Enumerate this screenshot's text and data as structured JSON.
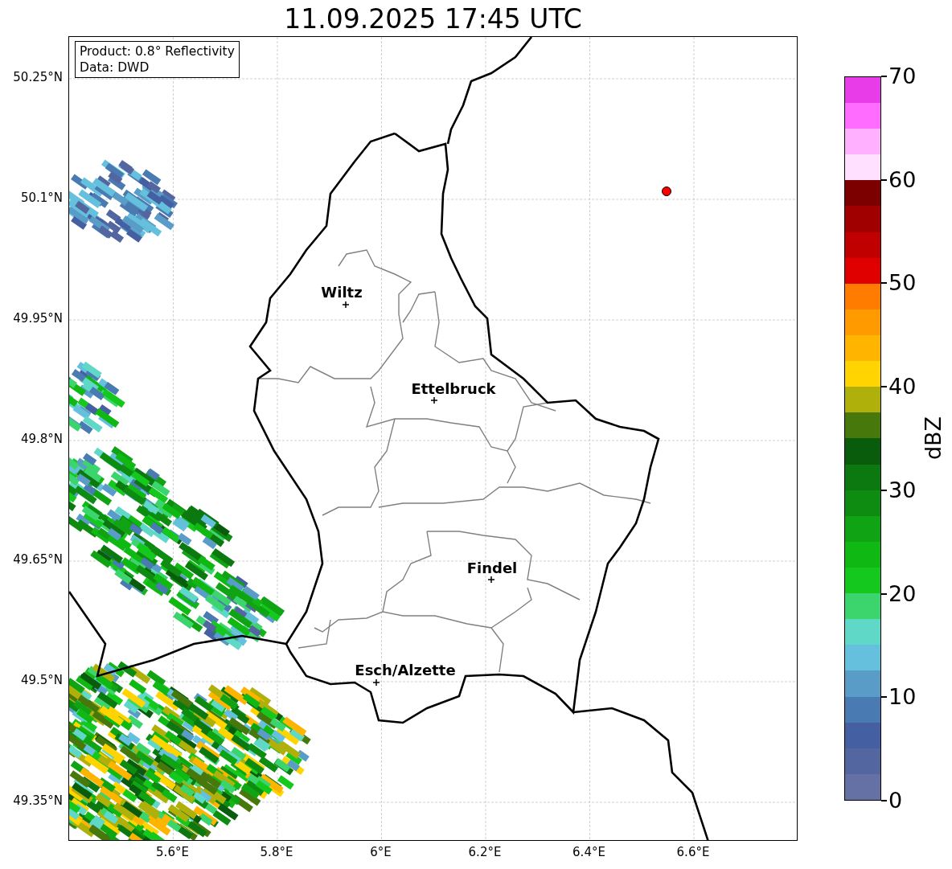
{
  "title": "11.09.2025 17:45 UTC",
  "info_box": {
    "lines": [
      "Product: 0.8° Reflectivity",
      "Data: DWD"
    ]
  },
  "map": {
    "y_ticks": [
      "50.25°N",
      "50.1°N",
      "49.95°N",
      "49.8°N",
      "49.65°N",
      "49.5°N",
      "49.35°N"
    ],
    "x_ticks": [
      "5.6°E",
      "5.8°E",
      "6°E",
      "6.2°E",
      "6.4°E",
      "6.6°E"
    ],
    "cities": [
      {
        "name": "Wiltz"
      },
      {
        "name": "Ettelbruck"
      },
      {
        "name": "Findel"
      },
      {
        "name": "Esch/Alzette"
      }
    ]
  },
  "colorbar": {
    "label": "dBZ",
    "ticks": [
      "70",
      "60",
      "50",
      "40",
      "30",
      "20",
      "10",
      "0"
    ],
    "bins": [
      {
        "color": "#6570a5"
      },
      {
        "color": "#5466a0"
      },
      {
        "color": "#4460a3"
      },
      {
        "color": "#4a7ab2"
      },
      {
        "color": "#5a9cc8"
      },
      {
        "color": "#64c0dc"
      },
      {
        "color": "#60d8c8"
      },
      {
        "color": "#3cd46c"
      },
      {
        "color": "#14c81e"
      },
      {
        "color": "#10b814"
      },
      {
        "color": "#10a414"
      },
      {
        "color": "#0e8c12"
      },
      {
        "color": "#0c7810"
      },
      {
        "color": "#085c0c"
      },
      {
        "color": "#46780c"
      },
      {
        "color": "#b0b00a"
      },
      {
        "color": "#ffd400"
      },
      {
        "color": "#ffb400"
      },
      {
        "color": "#ff9a00"
      },
      {
        "color": "#ff7c00"
      },
      {
        "color": "#e00000"
      },
      {
        "color": "#c00000"
      },
      {
        "color": "#a00000"
      },
      {
        "color": "#7c0000"
      },
      {
        "color": "#ffe0ff"
      },
      {
        "color": "#ffb0ff"
      },
      {
        "color": "#ff6cff"
      },
      {
        "color": "#e83ce8"
      }
    ]
  }
}
